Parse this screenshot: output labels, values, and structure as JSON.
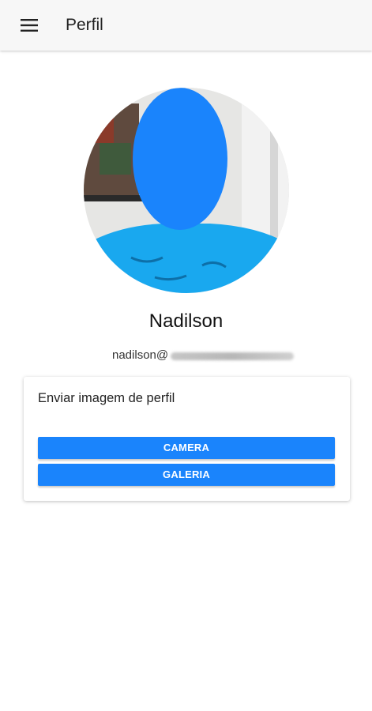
{
  "appbar": {
    "title": "Perfil",
    "menu_icon": "menu-icon"
  },
  "profile": {
    "name": "Nadilson",
    "email_visible": "nadilson@",
    "email_redacted": true,
    "face_redaction_color": "#1a84fc",
    "shirt_color": "#19a8ef"
  },
  "upload_card": {
    "title": "Enviar imagem de perfil",
    "camera_label": "CAMERA",
    "galeria_label": "GALERIA",
    "button_color": "#1a84fc"
  }
}
